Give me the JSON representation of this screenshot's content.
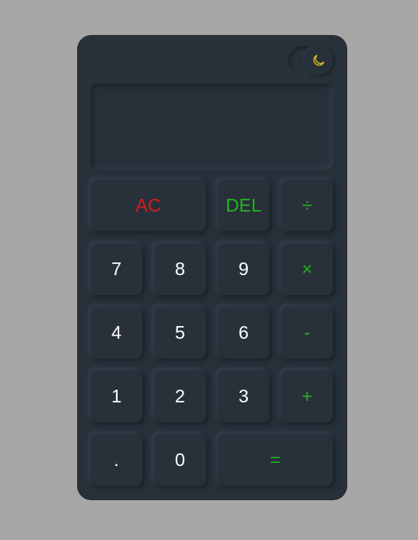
{
  "display": {
    "value": ""
  },
  "theme_toggle": {
    "icon": "moon-icon",
    "icon_color": "#e5c51a"
  },
  "colors": {
    "background": "#a6a6a6",
    "calculator": "#28303a",
    "digit": "#ffffff",
    "operator": "#1fb51f",
    "clear": "#d81d1d"
  },
  "keys": {
    "ac": "AC",
    "del": "DEL",
    "divide": "÷",
    "seven": "7",
    "eight": "8",
    "nine": "9",
    "multiply": "×",
    "four": "4",
    "five": "5",
    "six": "6",
    "minus": "-",
    "one": "1",
    "two": "2",
    "three": "3",
    "plus": "+",
    "dot": ".",
    "zero": "0",
    "equals": "="
  }
}
